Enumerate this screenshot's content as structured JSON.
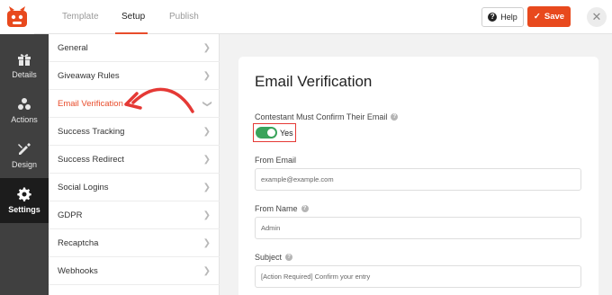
{
  "header": {
    "tabs": [
      {
        "label": "Template"
      },
      {
        "label": "Setup"
      },
      {
        "label": "Publish"
      }
    ],
    "help_label": "Help",
    "save_label": "Save"
  },
  "iconbar": {
    "items": [
      {
        "label": "Details",
        "icon": "gift-icon"
      },
      {
        "label": "Actions",
        "icon": "actions-icon"
      },
      {
        "label": "Design",
        "icon": "design-icon"
      },
      {
        "label": "Settings",
        "icon": "gear-icon"
      }
    ]
  },
  "settings": {
    "items": [
      {
        "label": "General"
      },
      {
        "label": "Giveaway Rules"
      },
      {
        "label": "Email Verification"
      },
      {
        "label": "Success Tracking"
      },
      {
        "label": "Success Redirect"
      },
      {
        "label": "Social Logins"
      },
      {
        "label": "GDPR"
      },
      {
        "label": "Recaptcha"
      },
      {
        "label": "Webhooks"
      }
    ]
  },
  "main": {
    "title": "Email Verification",
    "confirm_label": "Contestant Must Confirm Their Email",
    "confirm_value": "Yes",
    "from_email_label": "From Email",
    "from_email_value": "example@example.com",
    "from_name_label": "From Name",
    "from_name_value": "Admin",
    "subject_label": "Subject",
    "subject_value": "[Action Required] Confirm your entry"
  },
  "colors": {
    "accent": "#e84c2b",
    "save": "#e8491d",
    "toggle_on": "#3aa35b",
    "highlight": "#e53935",
    "sidebar_dark": "#404040"
  }
}
